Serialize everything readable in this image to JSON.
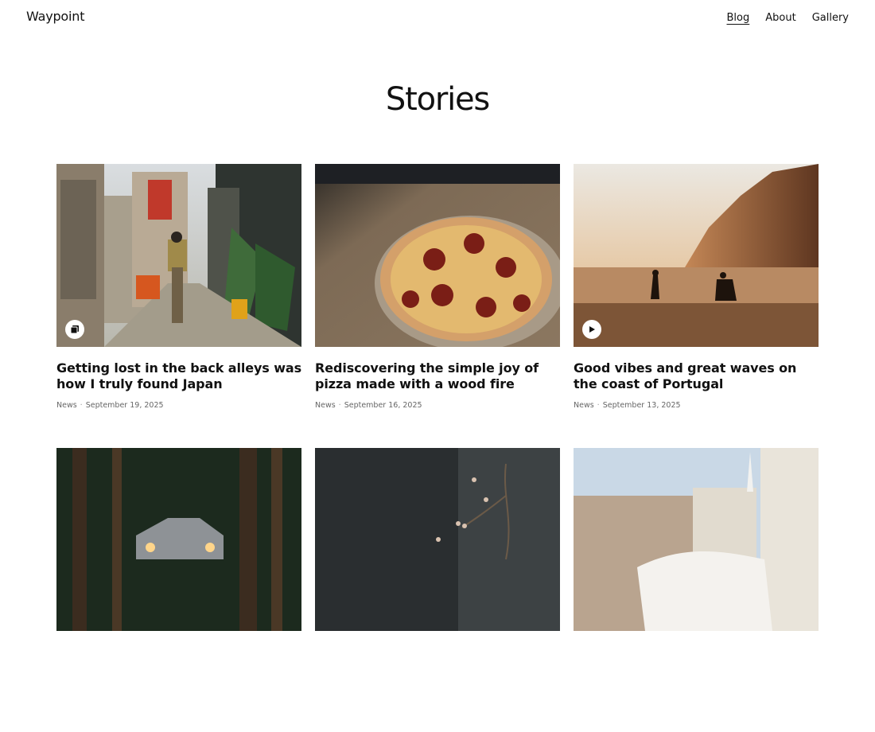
{
  "brand": "Waypoint",
  "nav": [
    {
      "label": "Blog",
      "active": true
    },
    {
      "label": "About",
      "active": false
    },
    {
      "label": "Gallery",
      "active": false
    }
  ],
  "page_title": "Stories",
  "posts": [
    {
      "title": "Getting lost in the back alleys was how I truly found Japan",
      "category": "News",
      "date": "September 19, 2025",
      "media": "gallery-icon"
    },
    {
      "title": "Rediscovering the simple joy of pizza made with a wood fire",
      "category": "News",
      "date": "September 16, 2025",
      "media": ""
    },
    {
      "title": "Good vibes and great waves on the coast of Portugal",
      "category": "News",
      "date": "September 13, 2025",
      "media": "play-icon"
    },
    {
      "title": "",
      "category": "",
      "date": "",
      "media": ""
    },
    {
      "title": "",
      "category": "",
      "date": "",
      "media": ""
    },
    {
      "title": "",
      "category": "",
      "date": "",
      "media": ""
    }
  ]
}
